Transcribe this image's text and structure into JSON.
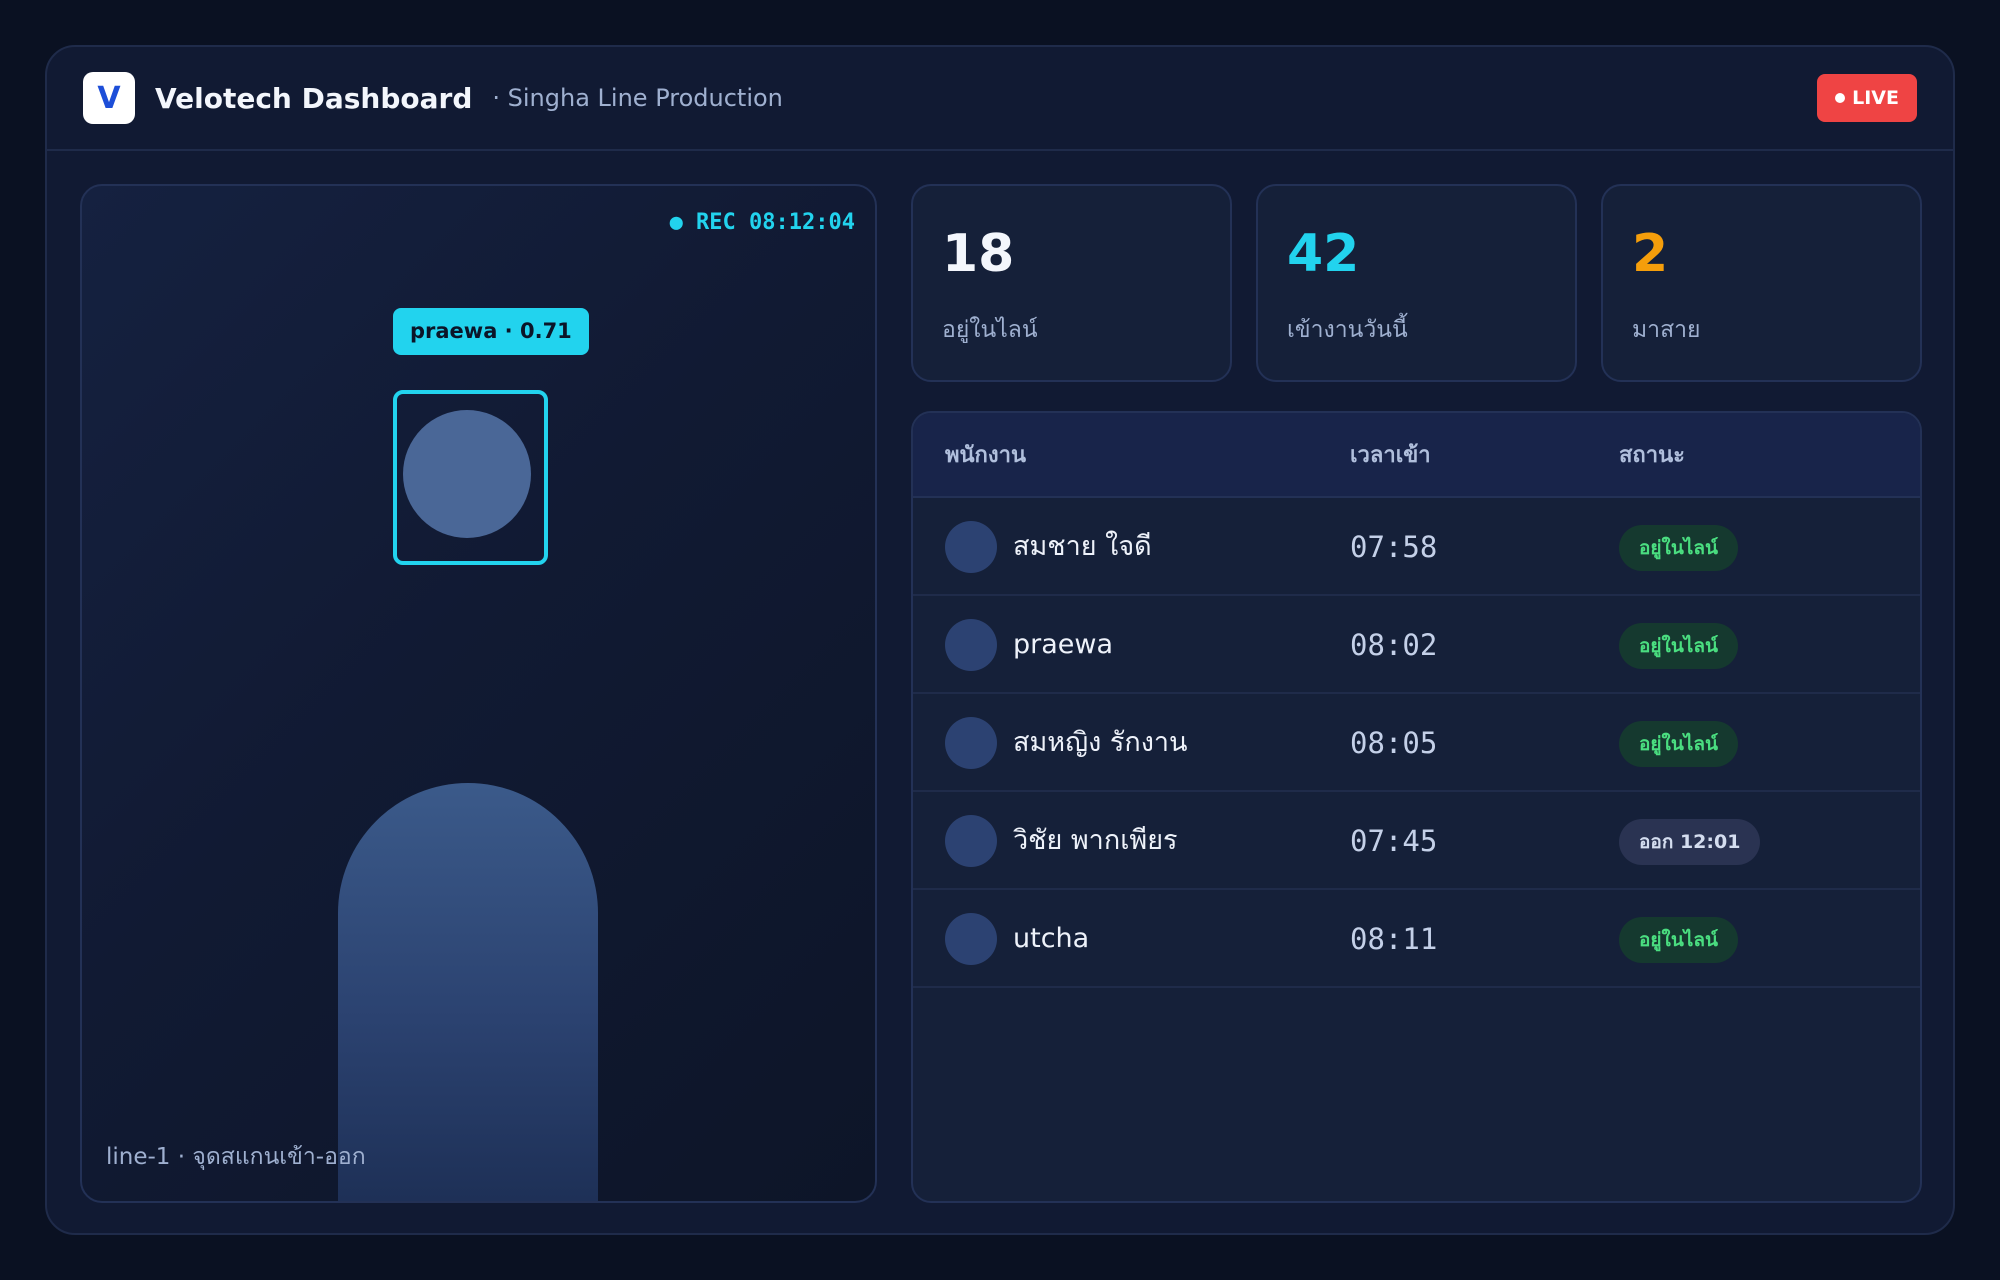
{
  "header": {
    "logo_letter": "V",
    "title": "Velotech Dashboard",
    "subtitle": "· Singha Line Production",
    "live_label": "LIVE"
  },
  "camera": {
    "rec_label": "● REC 08:12:04",
    "detection_label": "praewa · 0.71",
    "caption": "line-1 · จุดสแกนเข้า-ออก"
  },
  "stats": [
    {
      "value": "18",
      "label": "อยู่ในไลน์",
      "color": "#f3f6fc"
    },
    {
      "value": "42",
      "label": "เข้างานวันนี้",
      "color": "#22d3ee"
    },
    {
      "value": "2",
      "label": "มาสาย",
      "color": "#f59e0b"
    }
  ],
  "table": {
    "columns": [
      "พนักงาน",
      "เวลาเข้า",
      "สถานะ"
    ],
    "rows": [
      {
        "name": "สมชาย ใจดี",
        "time": "07:58",
        "status": "อยู่ในไลน์",
        "status_kind": "in"
      },
      {
        "name": "praewa",
        "time": "08:02",
        "status": "อยู่ในไลน์",
        "status_kind": "in"
      },
      {
        "name": "สมหญิง รักงาน",
        "time": "08:05",
        "status": "อยู่ในไลน์",
        "status_kind": "in"
      },
      {
        "name": "วิชัย พากเพียร",
        "time": "07:45",
        "status": "ออก 12:01",
        "status_kind": "out"
      },
      {
        "name": "utcha",
        "time": "08:11",
        "status": "อยู่ในไลน์",
        "status_kind": "in"
      }
    ]
  },
  "colors": {
    "accent": "#22d3ee",
    "live": "#ef4444",
    "late": "#f59e0b",
    "status_in": "#4ade80"
  }
}
